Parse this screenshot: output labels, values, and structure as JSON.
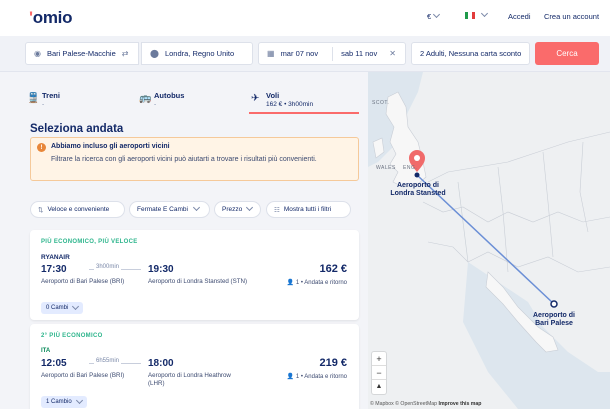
{
  "header": {
    "logo_prefix": "'",
    "logo_text": "omio",
    "currency": "€",
    "access": "Accedi",
    "signup": "Crea un account"
  },
  "search": {
    "from": "Bari Palese-Macchie",
    "to": "Londra, Regno Unito",
    "depart_date": "mar 07 nov",
    "return_date": "sab 11 nov",
    "passengers": "2 Adulti, Nessuna carta sconto",
    "search_label": "Cerca"
  },
  "tabs": [
    {
      "name": "Treni",
      "sub": "-"
    },
    {
      "name": "Autobus",
      "sub": "-"
    },
    {
      "name": "Voli",
      "sub": "162 € • 3h00min"
    }
  ],
  "section_title": "Seleziona andata",
  "alert": {
    "icon": "!",
    "title": "Abbiamo incluso gli aeroporti vicini",
    "text": "Filtrare la ricerca con gli aeroporti vicini può aiutarti a trovare i risultati più convenienti."
  },
  "filters": [
    {
      "label": "Veloce e conveniente",
      "icon": "sort-icon"
    },
    {
      "label": "Fermate E Cambi",
      "icon": "chevron-down-icon"
    },
    {
      "label": "Prezzo",
      "icon": "chevron-down-icon"
    },
    {
      "label": "Mostra tutti i filtri",
      "icon": "sliders-icon"
    }
  ],
  "results": [
    {
      "badge": "PIÙ ECONOMICO, PIÙ VELOCE",
      "airline": "RYANAIR",
      "dep_time": "17:30",
      "duration": "3h00min",
      "arr_time": "19:30",
      "dep_airport": "Aeroporto di Bari Palese (BRI)",
      "arr_airport": "Aeroporto di Londra Stansted (STN)",
      "price": "162 €",
      "price_note": "1 • Andata e ritorno",
      "changes": "0 Cambi"
    },
    {
      "badge": "2° PIÙ ECONOMICO",
      "airline": "ITA",
      "dep_time": "12:05",
      "duration": "6h55min",
      "arr_time": "18:00",
      "dep_airport": "Aeroporto di Bari Palese (BRI)",
      "arr_airport": "Aeroporto di Londra Heathrow (LHR)",
      "price": "219 €",
      "price_note": "1 • Andata e ritorno",
      "changes": "1 Cambio"
    }
  ],
  "map": {
    "origin_label": "Aeroporto di Londra Stansted",
    "dest_label": "Aeroporto di Bari Palese",
    "scot": "SCOT.",
    "wales": "WALES",
    "eng": "ENG.",
    "zoom_in": "+",
    "zoom_out": "−",
    "compass": "▲",
    "attribution_1": "© Mapbox © OpenStreetMap",
    "attribution_2": "Improve this map",
    "route_color": "#6b8fd6"
  },
  "colors": {
    "brand": "#132968",
    "accent": "#fa6b6b",
    "badge_green": "#2db58c"
  }
}
